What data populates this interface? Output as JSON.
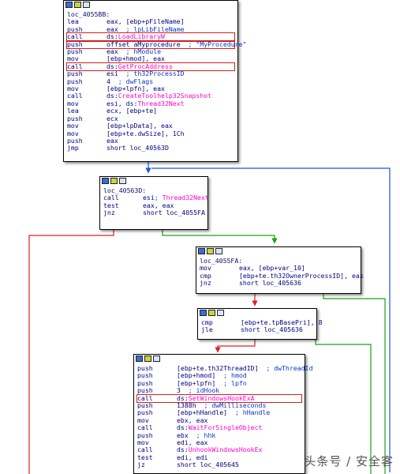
{
  "blocks": [
    {
      "lines": [
        {
          "kind": "label",
          "text": "loc_4055BB:"
        },
        {
          "m": "lea",
          "o": "eax, [ebp+pFileName]"
        },
        {
          "m": "push",
          "o": "eax",
          "c": "; lpLibFileName"
        },
        {
          "m": "call",
          "o": "ds:",
          "api": "LoadLibraryW",
          "hl": true
        },
        {
          "m": "push",
          "o": "offset aMyprocedure",
          "c": "; \"MyProcedure\"",
          "hl": true
        },
        {
          "m": "push",
          "o": "eax",
          "c": "; hModule"
        },
        {
          "m": "mov",
          "o": "[ebp+hmod], eax"
        },
        {
          "m": "call",
          "o": "ds:",
          "api": "GetProcAddress",
          "hl": true
        },
        {
          "m": "push",
          "o": "esi",
          "c": "; th32ProcessID"
        },
        {
          "m": "push",
          "o": "4",
          "c": "; dwFlags"
        },
        {
          "m": "mov",
          "o": "[ebp+lpfn], eax"
        },
        {
          "m": "call",
          "o": "ds:",
          "api": "CreateToolhelp32Snapshot"
        },
        {
          "m": "mov",
          "o": "esi, ds:",
          "api": "Thread32Next"
        },
        {
          "m": "lea",
          "o": "ecx, [ebp+te]"
        },
        {
          "m": "push",
          "o": "ecx"
        },
        {
          "m": "mov",
          "o": "[ebp+lpData], eax"
        },
        {
          "m": "mov",
          "o": "[ebp+te.dwSize], 1Ch"
        },
        {
          "m": "push",
          "o": "eax"
        },
        {
          "m": "jmp",
          "o": "short loc_40563D"
        }
      ]
    },
    {
      "lines": [
        {
          "kind": "label",
          "text": "loc_40563D:"
        },
        {
          "m": "call",
          "o": "esi",
          "c": "; ",
          "api": "Thread32Next"
        },
        {
          "m": "test",
          "o": "eax, eax"
        },
        {
          "m": "jnz",
          "o": "short loc_4055FA"
        }
      ]
    },
    {
      "lines": [
        {
          "kind": "label",
          "text": "loc_4055FA:"
        },
        {
          "m": "mov",
          "o": "eax, [ebp+var_10]"
        },
        {
          "m": "cmp",
          "o": "[ebp+te.th32OwnerProcessID], eax"
        },
        {
          "m": "jnz",
          "o": "short loc_405636"
        }
      ]
    },
    {
      "lines": [
        {
          "m": "cmp",
          "o": "[ebp+te.tpBasePri], 8"
        },
        {
          "m": "jle",
          "o": "short loc_405636"
        }
      ]
    },
    {
      "lines": [
        {
          "m": "push",
          "o": "[ebp+te.th32ThreadID]",
          "c": "; dwThreadId"
        },
        {
          "m": "push",
          "o": "[ebp+hmod]",
          "c": "; hmod"
        },
        {
          "m": "push",
          "o": "[ebp+lpfn]",
          "c": "; lpfn"
        },
        {
          "m": "push",
          "o": "3",
          "c": "; idHook"
        },
        {
          "m": "call",
          "o": "ds:",
          "api": "SetWindowsHookExA",
          "hl": true
        },
        {
          "m": "push",
          "o": "1388h",
          "c": "; dwMilliseconds"
        },
        {
          "m": "push",
          "o": "[ebp+hHandle]",
          "c": "; hHandle"
        },
        {
          "m": "mov",
          "o": "ebx, eax"
        },
        {
          "m": "call",
          "o": "ds:",
          "api": "WaitForSingleObject"
        },
        {
          "m": "push",
          "o": "ebx",
          "c": "; hhk"
        },
        {
          "m": "mov",
          "o": "edi, eax"
        },
        {
          "m": "call",
          "o": "ds:",
          "api": "UnhookWindowsHookEx"
        },
        {
          "m": "test",
          "o": "edi, edi"
        },
        {
          "m": "jz",
          "o": "short loc_405645"
        }
      ]
    }
  ],
  "watermark": "头条号 / 安全客",
  "colors": {
    "true_edge": "#1aa01a",
    "false_edge": "#e02020",
    "loop_edge": "#1a55e0",
    "api": "#ff00c8",
    "highlight_box": "#d02020"
  }
}
